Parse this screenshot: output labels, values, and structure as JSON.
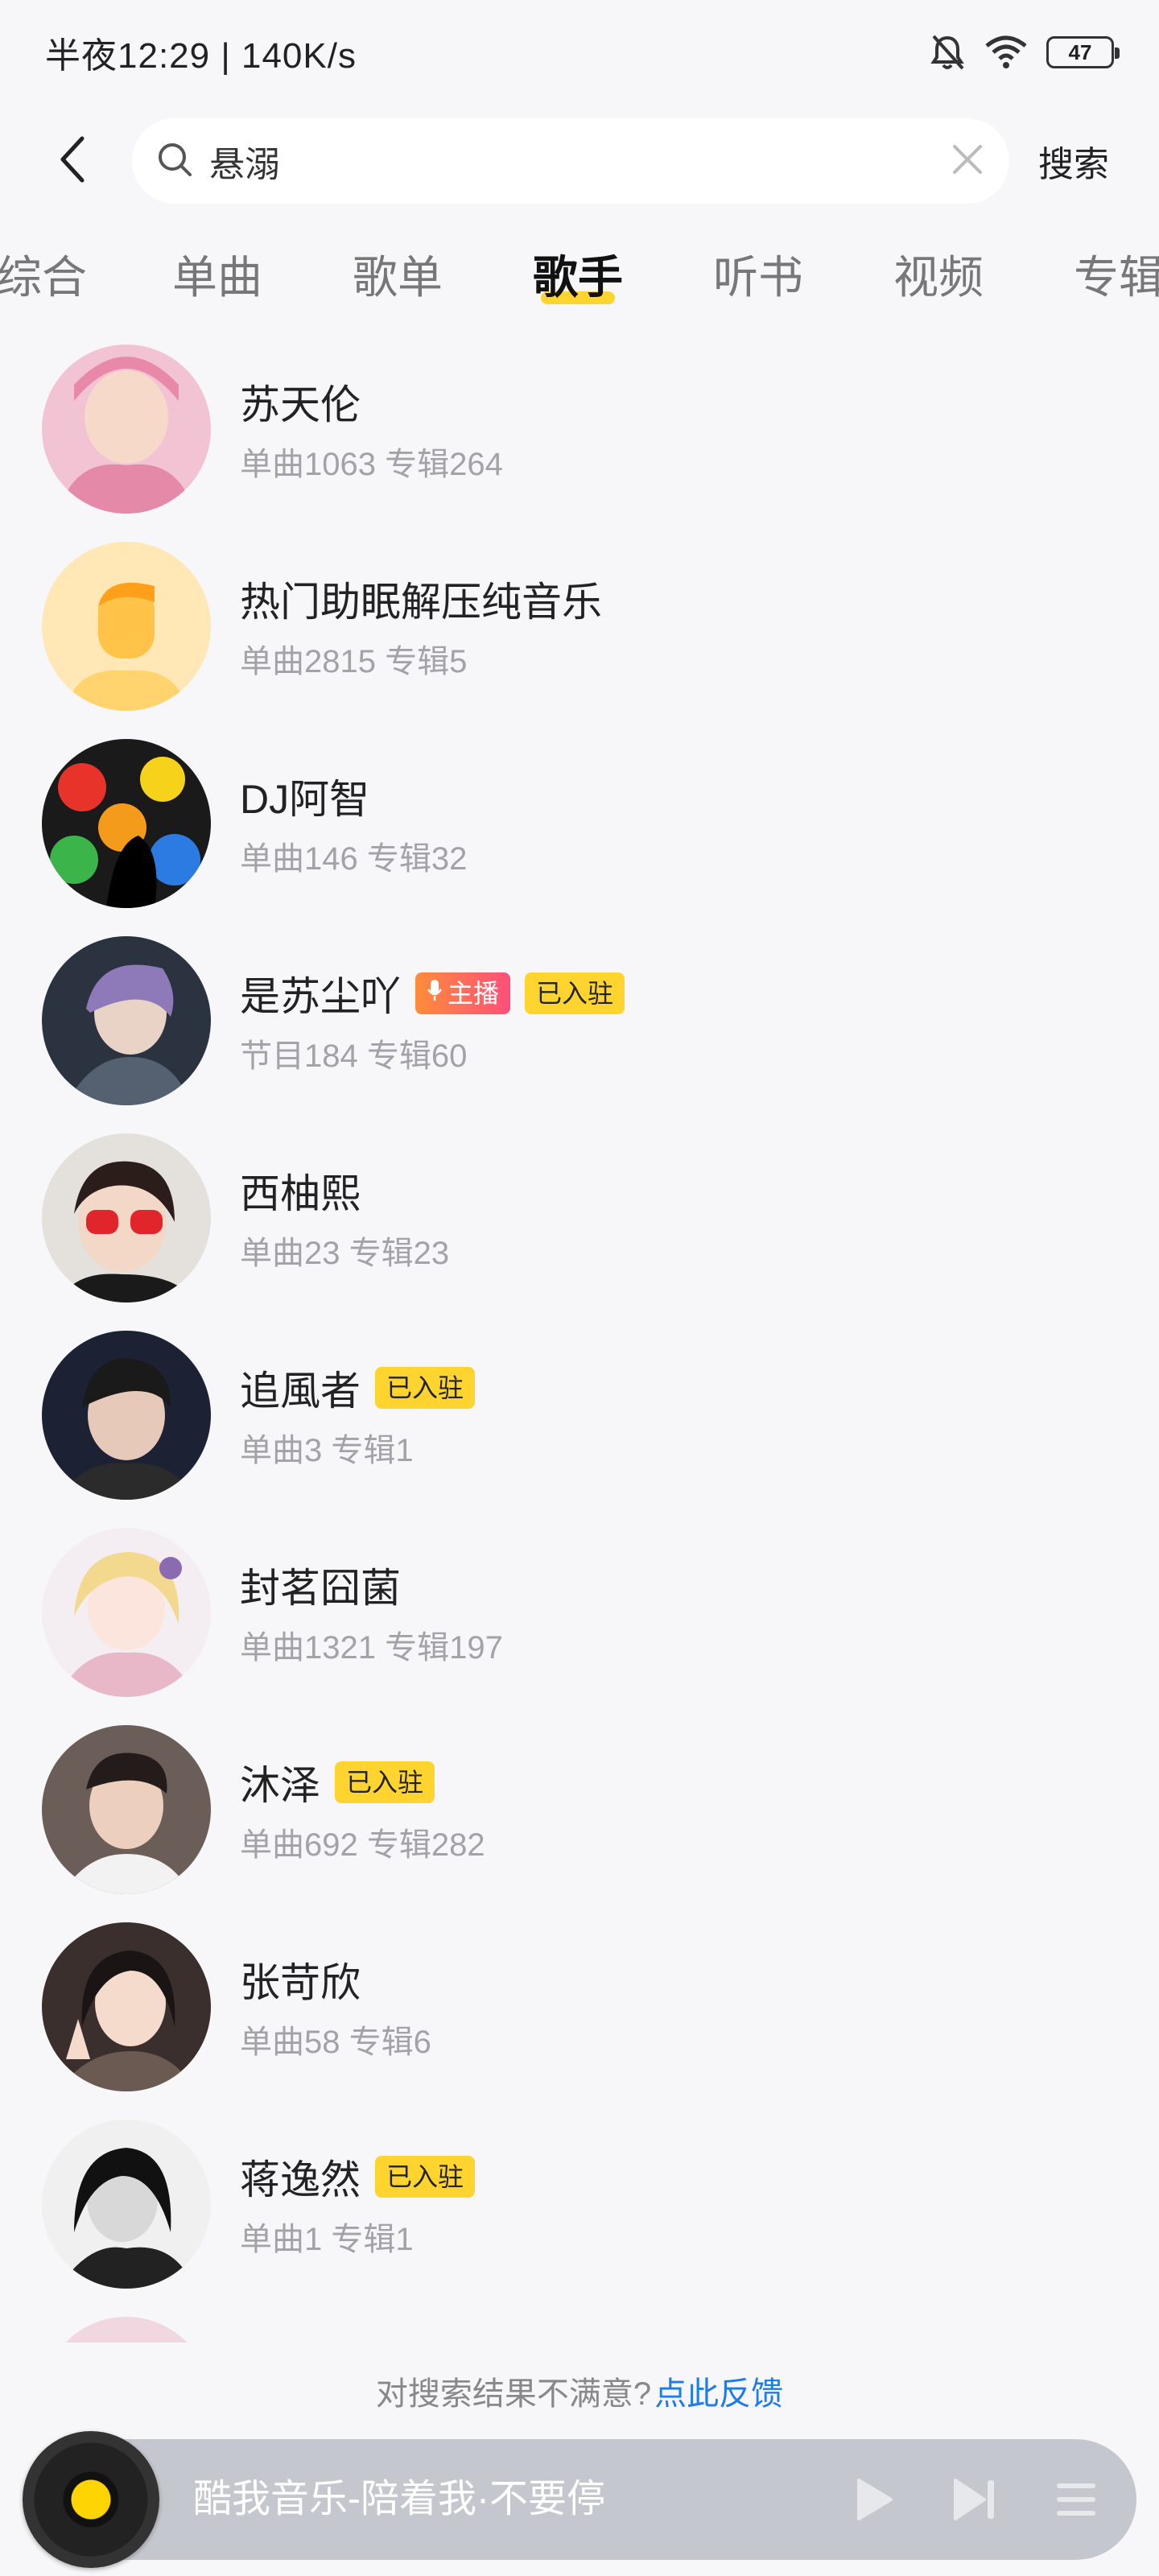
{
  "status_bar": {
    "time": "半夜12:29 | 140K/s",
    "battery": "47"
  },
  "search": {
    "query": "悬溺",
    "submit_label": "搜索"
  },
  "tabs": [
    {
      "label": "综合",
      "active": false
    },
    {
      "label": "单曲",
      "active": false
    },
    {
      "label": "歌单",
      "active": false
    },
    {
      "label": "歌手",
      "active": true
    },
    {
      "label": "听书",
      "active": false
    },
    {
      "label": "视频",
      "active": false
    },
    {
      "label": "专辑",
      "active": false
    }
  ],
  "artists": [
    {
      "name": "苏天伦",
      "stats": "单曲1063 专辑264",
      "badges": []
    },
    {
      "name": "热门助眠解压纯音乐",
      "stats": "单曲2815 专辑5",
      "badges": []
    },
    {
      "name": "DJ阿智",
      "stats": "单曲146 专辑32",
      "badges": []
    },
    {
      "name": "是苏尘吖",
      "stats": "节目184 专辑60",
      "badges": [
        "主播",
        "已入驻"
      ]
    },
    {
      "name": "西柚熙",
      "stats": "单曲23 专辑23",
      "badges": []
    },
    {
      "name": "追風者",
      "stats": "单曲3 专辑1",
      "badges": [
        "已入驻"
      ]
    },
    {
      "name": "封茗囧菌",
      "stats": "单曲1321 专辑197",
      "badges": []
    },
    {
      "name": "沐泽",
      "stats": "单曲692 专辑282",
      "badges": [
        "已入驻"
      ]
    },
    {
      "name": "张苛欣",
      "stats": "单曲58 专辑6",
      "badges": []
    },
    {
      "name": "蒋逸然",
      "stats": "单曲1 专辑1",
      "badges": [
        "已入驻"
      ]
    }
  ],
  "badge_labels": {
    "settled": "已入驻",
    "anchor": "主播"
  },
  "feedback": {
    "text": "对搜索结果不满意?",
    "link": "点此反馈"
  },
  "player": {
    "title": "酷我音乐-陪着我·不要停"
  },
  "colors": {
    "accent_yellow": "#ffd42e",
    "link_blue": "#1e7be8",
    "background": "#f7f7f9"
  }
}
